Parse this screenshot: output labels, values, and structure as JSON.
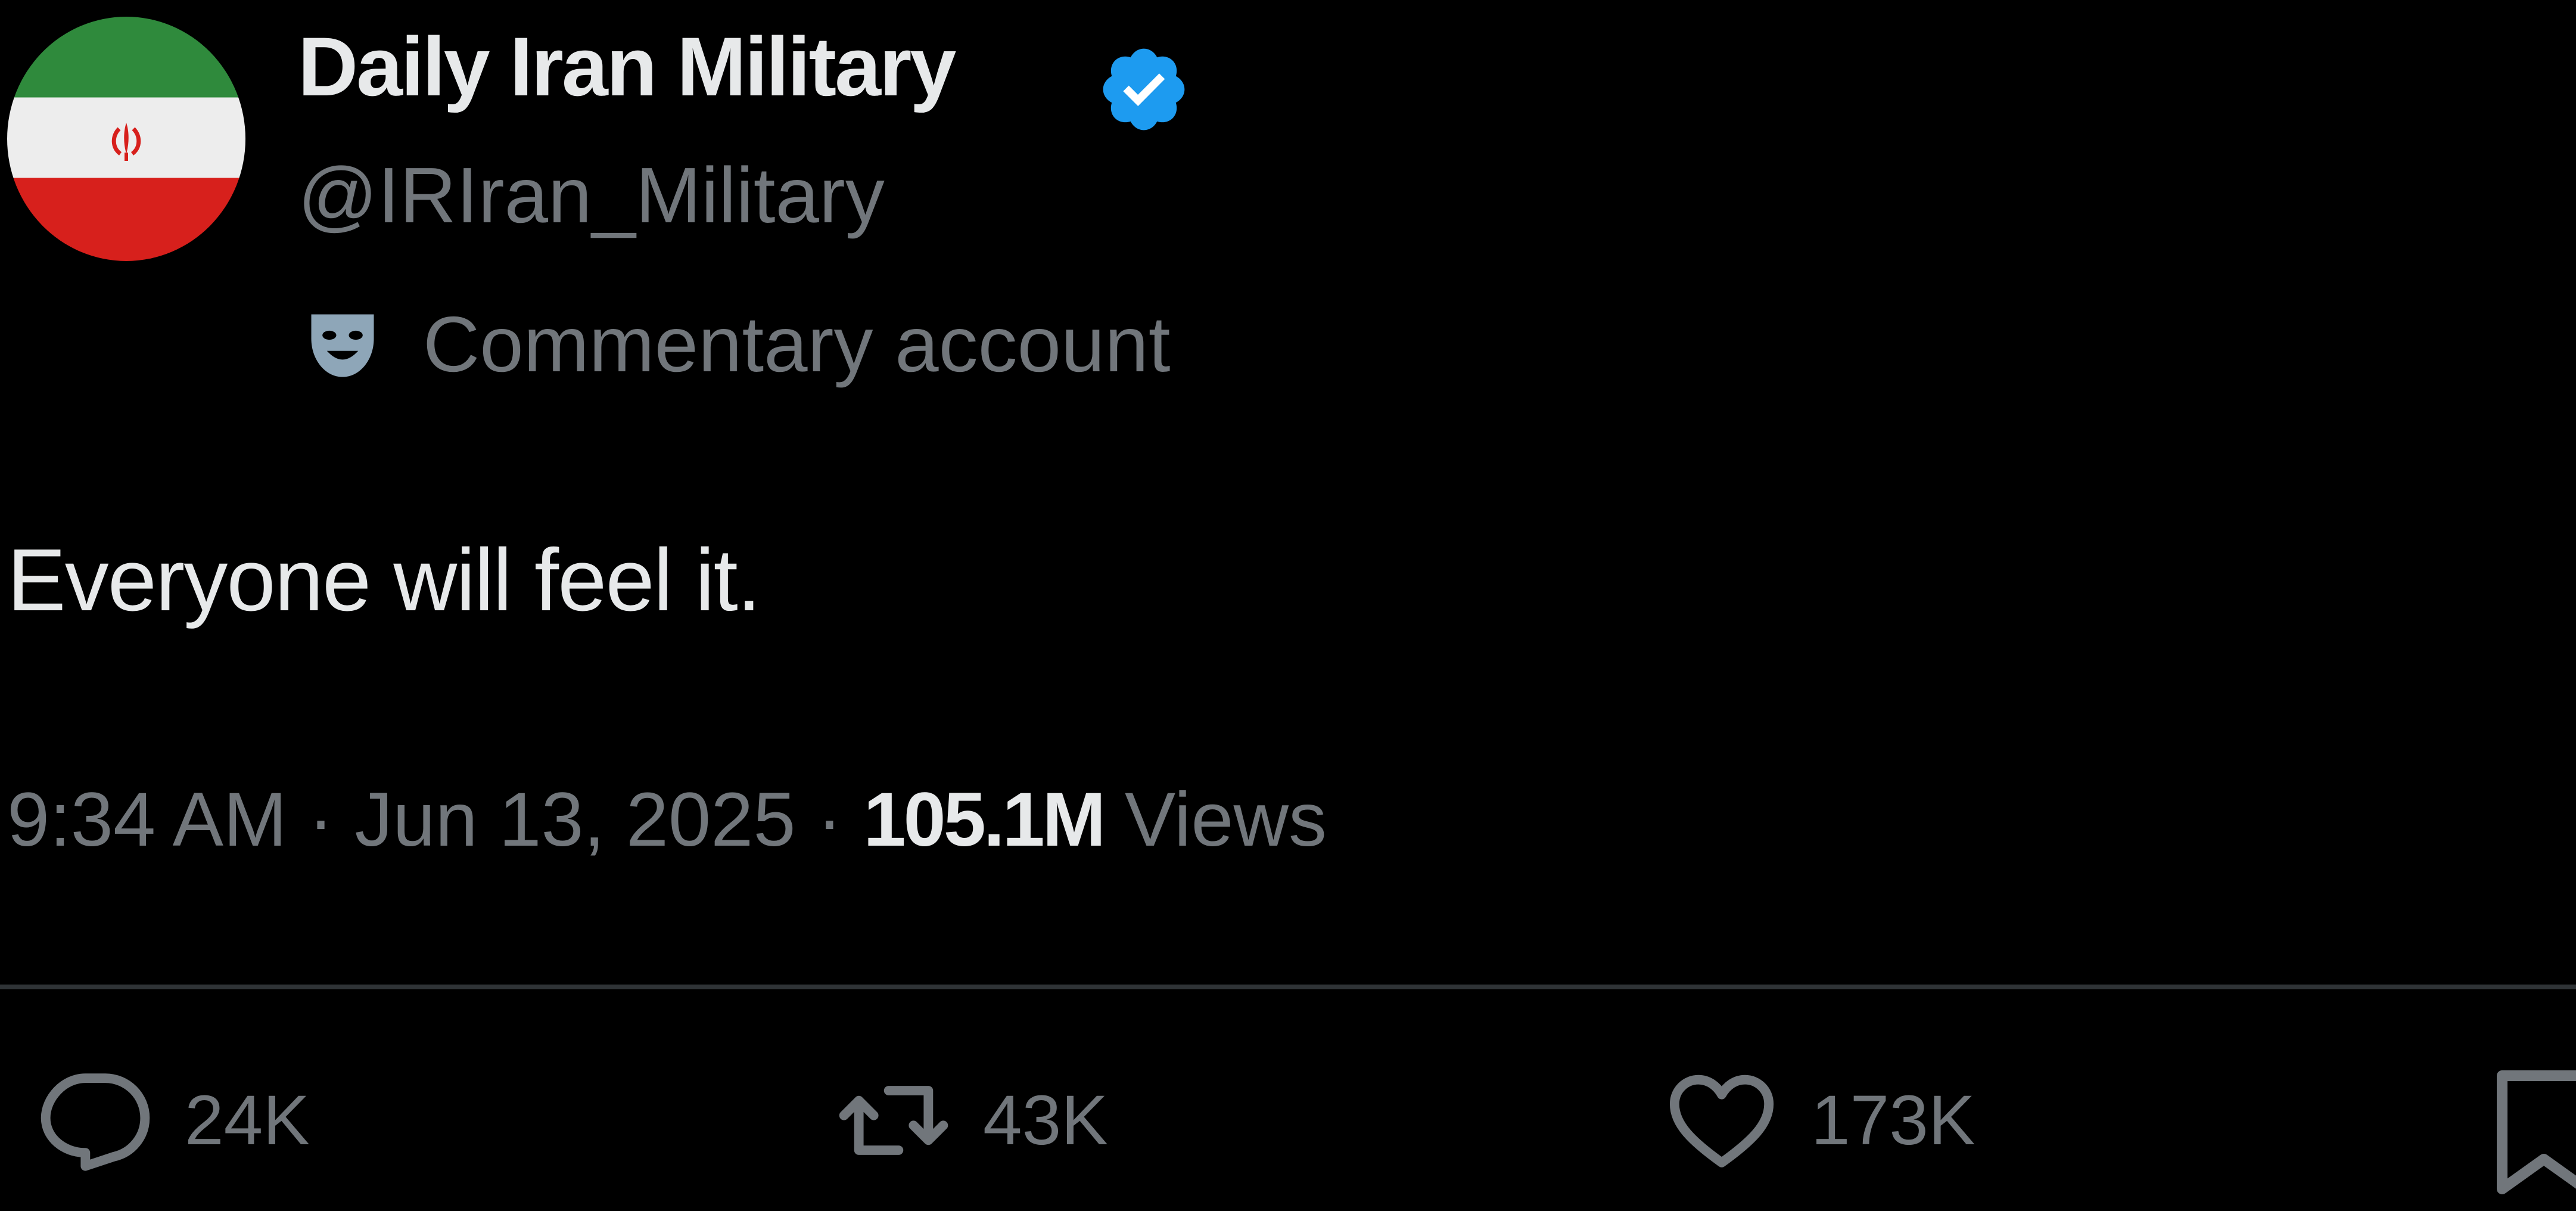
{
  "tweet": {
    "author": {
      "display_name": "Daily Iran Military",
      "handle": "@IRIran_Military",
      "label": "Commentary account",
      "verified_color": "#1d9bf0",
      "avatar_icon": "iran-flag-icon",
      "label_icon": "theater-mask-icon"
    },
    "text": "Everyone will feel it.",
    "time": "9:34 AM",
    "separator": "·",
    "date": "Jun 13, 2025",
    "views_count": "105.1M",
    "views_label": "Views"
  },
  "actions": {
    "replies": "24K",
    "reposts": "43K",
    "likes": "173K"
  },
  "colors": {
    "background": "#000000",
    "primary_text": "#e7e9ea",
    "secondary_text": "#71767b",
    "divider": "#2f3336",
    "flag_green": "#2f8a3c",
    "flag_white": "#ededed",
    "flag_red": "#d7201c"
  }
}
